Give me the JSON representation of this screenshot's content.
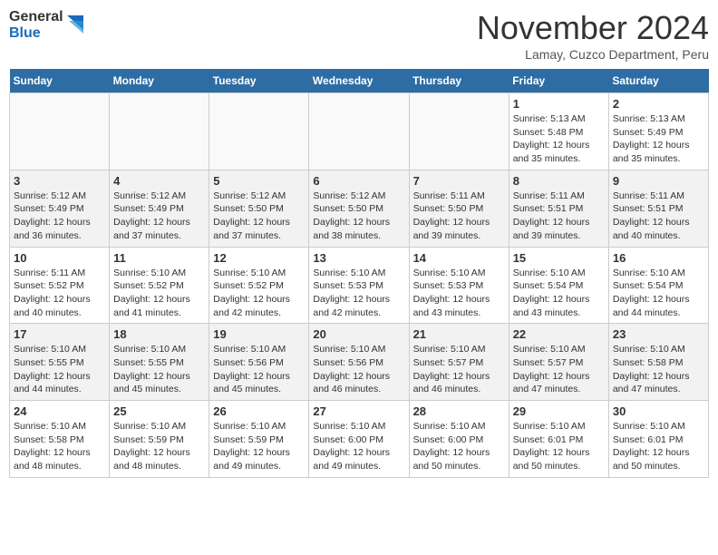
{
  "header": {
    "logo_general": "General",
    "logo_blue": "Blue",
    "month_title": "November 2024",
    "location": "Lamay, Cuzco Department, Peru"
  },
  "days_of_week": [
    "Sunday",
    "Monday",
    "Tuesday",
    "Wednesday",
    "Thursday",
    "Friday",
    "Saturday"
  ],
  "weeks": [
    [
      {
        "day": "",
        "info": ""
      },
      {
        "day": "",
        "info": ""
      },
      {
        "day": "",
        "info": ""
      },
      {
        "day": "",
        "info": ""
      },
      {
        "day": "",
        "info": ""
      },
      {
        "day": "1",
        "info": "Sunrise: 5:13 AM\nSunset: 5:48 PM\nDaylight: 12 hours and 35 minutes."
      },
      {
        "day": "2",
        "info": "Sunrise: 5:13 AM\nSunset: 5:49 PM\nDaylight: 12 hours and 35 minutes."
      }
    ],
    [
      {
        "day": "3",
        "info": "Sunrise: 5:12 AM\nSunset: 5:49 PM\nDaylight: 12 hours and 36 minutes."
      },
      {
        "day": "4",
        "info": "Sunrise: 5:12 AM\nSunset: 5:49 PM\nDaylight: 12 hours and 37 minutes."
      },
      {
        "day": "5",
        "info": "Sunrise: 5:12 AM\nSunset: 5:50 PM\nDaylight: 12 hours and 37 minutes."
      },
      {
        "day": "6",
        "info": "Sunrise: 5:12 AM\nSunset: 5:50 PM\nDaylight: 12 hours and 38 minutes."
      },
      {
        "day": "7",
        "info": "Sunrise: 5:11 AM\nSunset: 5:50 PM\nDaylight: 12 hours and 39 minutes."
      },
      {
        "day": "8",
        "info": "Sunrise: 5:11 AM\nSunset: 5:51 PM\nDaylight: 12 hours and 39 minutes."
      },
      {
        "day": "9",
        "info": "Sunrise: 5:11 AM\nSunset: 5:51 PM\nDaylight: 12 hours and 40 minutes."
      }
    ],
    [
      {
        "day": "10",
        "info": "Sunrise: 5:11 AM\nSunset: 5:52 PM\nDaylight: 12 hours and 40 minutes."
      },
      {
        "day": "11",
        "info": "Sunrise: 5:10 AM\nSunset: 5:52 PM\nDaylight: 12 hours and 41 minutes."
      },
      {
        "day": "12",
        "info": "Sunrise: 5:10 AM\nSunset: 5:52 PM\nDaylight: 12 hours and 42 minutes."
      },
      {
        "day": "13",
        "info": "Sunrise: 5:10 AM\nSunset: 5:53 PM\nDaylight: 12 hours and 42 minutes."
      },
      {
        "day": "14",
        "info": "Sunrise: 5:10 AM\nSunset: 5:53 PM\nDaylight: 12 hours and 43 minutes."
      },
      {
        "day": "15",
        "info": "Sunrise: 5:10 AM\nSunset: 5:54 PM\nDaylight: 12 hours and 43 minutes."
      },
      {
        "day": "16",
        "info": "Sunrise: 5:10 AM\nSunset: 5:54 PM\nDaylight: 12 hours and 44 minutes."
      }
    ],
    [
      {
        "day": "17",
        "info": "Sunrise: 5:10 AM\nSunset: 5:55 PM\nDaylight: 12 hours and 44 minutes."
      },
      {
        "day": "18",
        "info": "Sunrise: 5:10 AM\nSunset: 5:55 PM\nDaylight: 12 hours and 45 minutes."
      },
      {
        "day": "19",
        "info": "Sunrise: 5:10 AM\nSunset: 5:56 PM\nDaylight: 12 hours and 45 minutes."
      },
      {
        "day": "20",
        "info": "Sunrise: 5:10 AM\nSunset: 5:56 PM\nDaylight: 12 hours and 46 minutes."
      },
      {
        "day": "21",
        "info": "Sunrise: 5:10 AM\nSunset: 5:57 PM\nDaylight: 12 hours and 46 minutes."
      },
      {
        "day": "22",
        "info": "Sunrise: 5:10 AM\nSunset: 5:57 PM\nDaylight: 12 hours and 47 minutes."
      },
      {
        "day": "23",
        "info": "Sunrise: 5:10 AM\nSunset: 5:58 PM\nDaylight: 12 hours and 47 minutes."
      }
    ],
    [
      {
        "day": "24",
        "info": "Sunrise: 5:10 AM\nSunset: 5:58 PM\nDaylight: 12 hours and 48 minutes."
      },
      {
        "day": "25",
        "info": "Sunrise: 5:10 AM\nSunset: 5:59 PM\nDaylight: 12 hours and 48 minutes."
      },
      {
        "day": "26",
        "info": "Sunrise: 5:10 AM\nSunset: 5:59 PM\nDaylight: 12 hours and 49 minutes."
      },
      {
        "day": "27",
        "info": "Sunrise: 5:10 AM\nSunset: 6:00 PM\nDaylight: 12 hours and 49 minutes."
      },
      {
        "day": "28",
        "info": "Sunrise: 5:10 AM\nSunset: 6:00 PM\nDaylight: 12 hours and 50 minutes."
      },
      {
        "day": "29",
        "info": "Sunrise: 5:10 AM\nSunset: 6:01 PM\nDaylight: 12 hours and 50 minutes."
      },
      {
        "day": "30",
        "info": "Sunrise: 5:10 AM\nSunset: 6:01 PM\nDaylight: 12 hours and 50 minutes."
      }
    ]
  ]
}
